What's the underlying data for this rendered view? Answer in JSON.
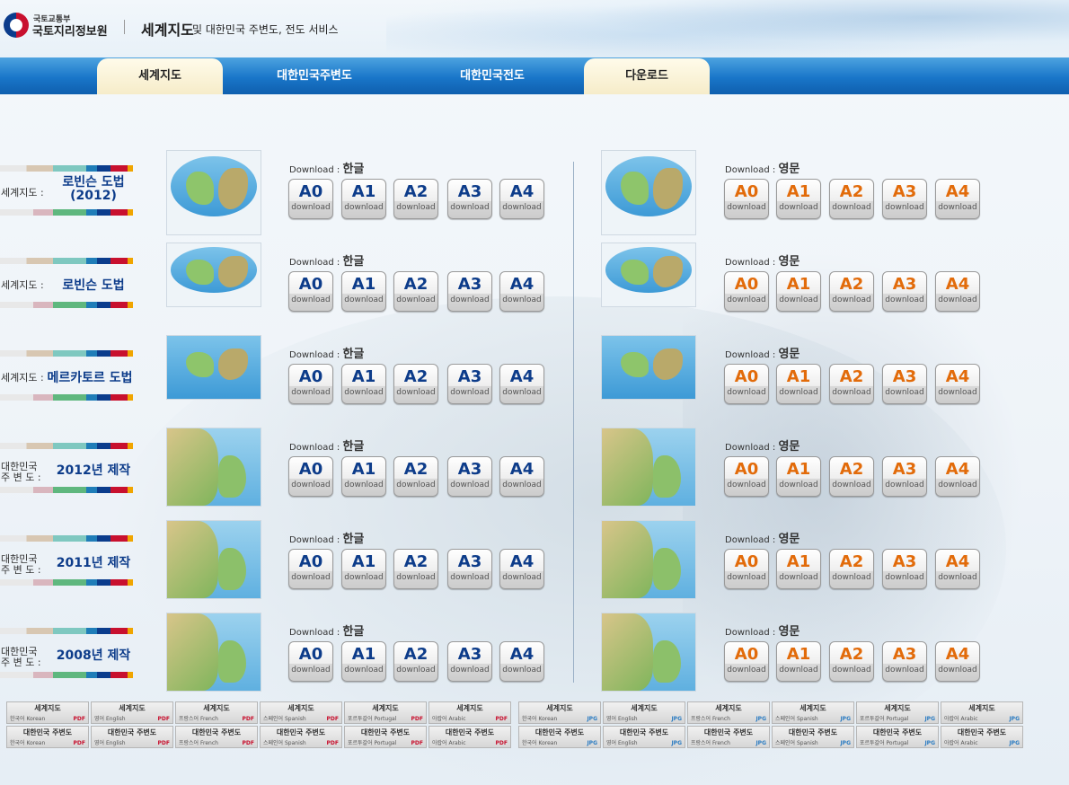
{
  "header": {
    "org_top": "국토교통부",
    "org_main": "국토지리정보원",
    "title": "세계지도",
    "subtitle": "및 대한민국 주변도, 전도 서비스"
  },
  "nav": {
    "tabs": [
      {
        "label": "세계지도",
        "active": true
      },
      {
        "label": "대한민국주변도",
        "active": false
      },
      {
        "label": "대한민국전도",
        "active": false
      },
      {
        "label": "다운로드",
        "active": true
      }
    ]
  },
  "common": {
    "download_word": "Download",
    "lang_ko": "한글",
    "lang_en": "영문",
    "sizes": [
      "A0",
      "A1",
      "A2",
      "A3",
      "A4"
    ],
    "btn_sub": "download"
  },
  "rows": [
    {
      "prefix": "세계지도 :",
      "name": "로빈슨 도법\n(2012)"
    },
    {
      "prefix": "세계지도 :",
      "name": "로빈슨 도법"
    },
    {
      "prefix": "세계지도 :",
      "name": "메르카토르 도법"
    },
    {
      "prefix": "대한민국\n주 변 도 :",
      "name": "2012년 제작"
    },
    {
      "prefix": "대한민국\n주 변 도 :",
      "name": "2011년 제작"
    },
    {
      "prefix": "대한민국\n주 변 도 :",
      "name": "2008년 제작"
    }
  ],
  "lang_buttons": {
    "row1_title": "세계지도",
    "row2_title": "대한민국 주변도",
    "languages": [
      "한국어 Korean",
      "영어 English",
      "프랑스어 French",
      "스페인어 Spanish",
      "포르투갈어 Portugal",
      "아랍어 Arabic"
    ],
    "pdf": "PDF",
    "jpg": "JPG"
  }
}
